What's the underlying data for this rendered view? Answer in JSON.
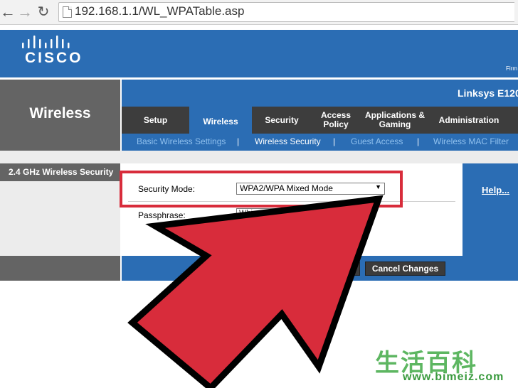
{
  "browser": {
    "back_icon": "arrow-left-icon",
    "forward_icon": "arrow-right-icon",
    "reload_icon": "reload-icon",
    "url": "192.168.1.1/WL_WPATable.asp"
  },
  "header": {
    "brand": "CISCO",
    "firmware_label": "Firm"
  },
  "section": {
    "title": "Wireless",
    "model": "Linksys E120"
  },
  "tabs": [
    {
      "label": "Setup"
    },
    {
      "label": "Wireless"
    },
    {
      "label": "Security"
    },
    {
      "label": "Access Policy"
    },
    {
      "label": "Applications & Gaming"
    },
    {
      "label": "Administration"
    }
  ],
  "subtabs": [
    {
      "label": "Basic Wireless Settings"
    },
    {
      "label": "Wireless Security"
    },
    {
      "label": "Guest Access"
    },
    {
      "label": "Wireless MAC Filter"
    }
  ],
  "separator": "|",
  "panel": {
    "left_title": "2.4 GHz Wireless Security",
    "security_mode_label": "Security Mode:",
    "security_mode_value": "WPA2/WPA Mixed Mode",
    "passphrase_label": "Passphrase:",
    "passphrase_value": "Whi",
    "help_link": "Help..."
  },
  "buttons": {
    "save": "nges",
    "cancel": "Cancel Changes"
  },
  "annotation": {
    "arrow_color": "#d82c3b",
    "outline_color": "#000000"
  },
  "watermark": {
    "cjk": "生活百科",
    "url": "www.bimeiz.com"
  },
  "colors": {
    "brand_blue": "#2b6db4",
    "dark_gray": "#3d3d3d",
    "mid_gray": "#646464"
  }
}
